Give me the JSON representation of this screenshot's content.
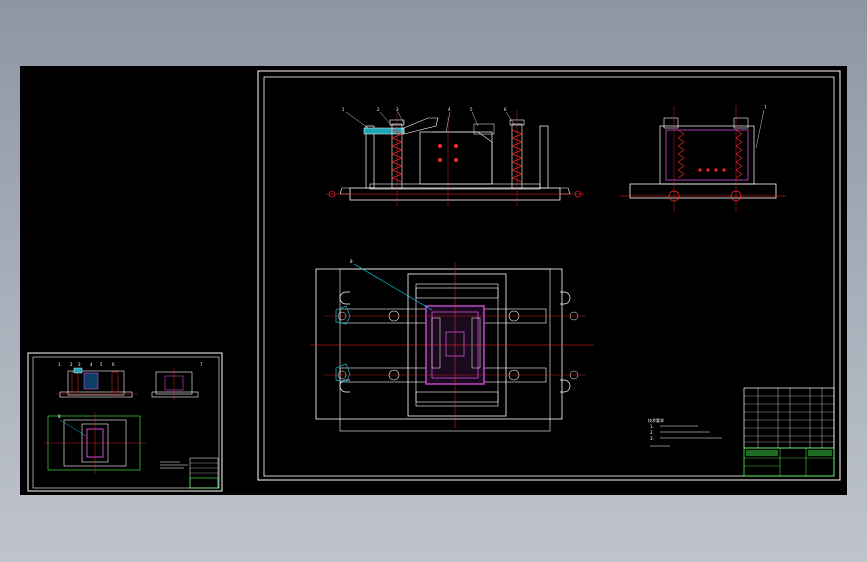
{
  "viewer": {
    "background_color": "#000000",
    "outer_color": "#9aa1ad"
  },
  "palette": {
    "frame": "#ffffff",
    "part": "#ffffff",
    "center_line": "#ff2a2a",
    "dimension": "#ff2a2a",
    "highlight": "#d24bd8",
    "leader": "#00e5ff",
    "title_block": "#4cff4c"
  },
  "sheet": {
    "front_view_balloons": [
      "1",
      "2",
      "3",
      "4",
      "5",
      "6"
    ],
    "side_view_balloons": [
      "7"
    ],
    "plan_view_balloons": [
      "8"
    ],
    "notes_title": "技术要求",
    "notes": [
      "1.",
      "2.",
      "3."
    ]
  },
  "thumbnail": {
    "front_view_balloons": [
      "1",
      "2",
      "3",
      "4",
      "5",
      "6"
    ],
    "side_view_balloons": [
      "7"
    ],
    "plan_view_balloons": [
      "8"
    ]
  }
}
